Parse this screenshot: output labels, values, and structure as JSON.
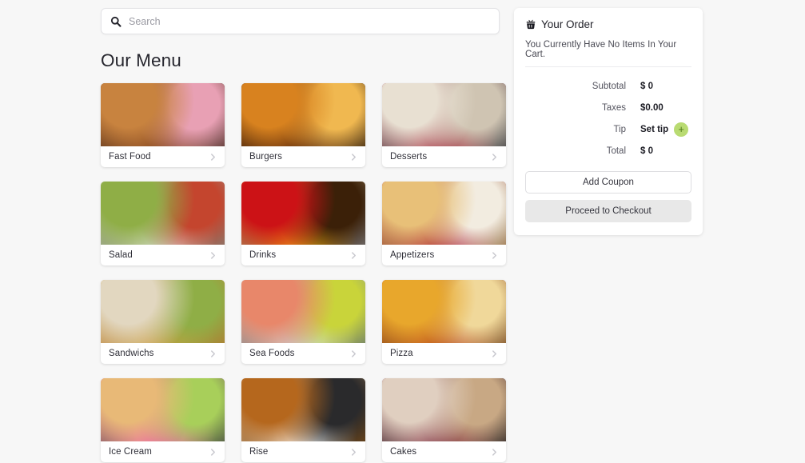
{
  "search": {
    "placeholder": "Search",
    "value": "",
    "icon": "search-icon"
  },
  "menu": {
    "title": "Our Menu",
    "chevron_icon": "chevron-right-icon",
    "items": [
      {
        "label": "Fast Food",
        "photo": "assorted-fast-food-donuts-burger-fries",
        "c1": "#c8833f",
        "c2": "#7a3d1c",
        "c3": "#e8a0b4",
        "c4": "#3a2014"
      },
      {
        "label": "Burgers",
        "photo": "flame-grilled-burger",
        "c1": "#d8821f",
        "c2": "#4a1c08",
        "c3": "#f0b850",
        "c4": "#1d0c04"
      },
      {
        "label": "Desserts",
        "photo": "berry-cream-pastry",
        "c1": "#e8e0d2",
        "c2": "#9c2436",
        "c3": "#cfc4b2",
        "c4": "#2e3036"
      },
      {
        "label": "Salad",
        "photo": "fresh-green-salad-bowl",
        "c1": "#8fae46",
        "c2": "#d8dbd4",
        "c3": "#c4452e",
        "c4": "#7d8279"
      },
      {
        "label": "Drinks",
        "photo": "cola-pour-into-glass",
        "c1": "#cc1216",
        "c2": "#e8a718",
        "c3": "#3b2008",
        "c4": "#7d7f84"
      },
      {
        "label": "Appetizers",
        "photo": "cranberry-cheese-crostini",
        "c1": "#e8c078",
        "c2": "#a81d2e",
        "c3": "#f2ece0",
        "c4": "#8a5f30"
      },
      {
        "label": "Sandwichs",
        "photo": "club-sandwich-with-chips",
        "c1": "#e2d7c0",
        "c2": "#c79a3c",
        "c3": "#8fae46",
        "c4": "#b5752e"
      },
      {
        "label": "Sea Foods",
        "photo": "grilled-shrimp-with-lemon",
        "c1": "#e8876a",
        "c2": "#c8d3d6",
        "c3": "#c9d43a",
        "c4": "#5f7076"
      },
      {
        "label": "Pizza",
        "photo": "cheese-pizza-slice-pull",
        "c1": "#e8a72c",
        "c2": "#b5431c",
        "c3": "#f0d89a",
        "c4": "#6d3a14"
      },
      {
        "label": "Ice Cream",
        "photo": "ice-cream-cones-assorted",
        "c1": "#e8b977",
        "c2": "#e85fa8",
        "c3": "#a8cf5a",
        "c4": "#3c3c40"
      },
      {
        "label": "Rise",
        "photo": "teriyaki-chicken-over-rice",
        "c1": "#b5671d",
        "c2": "#f2f2ee",
        "c3": "#2a2a2c",
        "c4": "#7a4a14"
      },
      {
        "label": "Cakes",
        "photo": "layered-cake-slices",
        "c1": "#e0cfc0",
        "c2": "#7a2438",
        "c3": "#c8a884",
        "c4": "#1a1418"
      }
    ]
  },
  "order": {
    "title": "Your Order",
    "basket_icon": "shopping-basket-icon",
    "empty_message": "You Currently Have No Items In Your Cart.",
    "rows": [
      {
        "label": "Subtotal",
        "value": "$ 0"
      },
      {
        "label": "Taxes",
        "value": "$0.00"
      },
      {
        "label": "Total",
        "value": "$ 0"
      }
    ],
    "tip": {
      "label": "Tip",
      "value": "Set tip",
      "add_icon": "plus-icon",
      "add_color": "#b9db72"
    },
    "coupon_label": "Add Coupon",
    "checkout_label": "Proceed to Checkout"
  },
  "colors": {
    "page_background": "#f7f7f7",
    "card_background": "#ffffff",
    "accent_green": "#b9db72",
    "checkout_gray": "#e8e8e8"
  }
}
